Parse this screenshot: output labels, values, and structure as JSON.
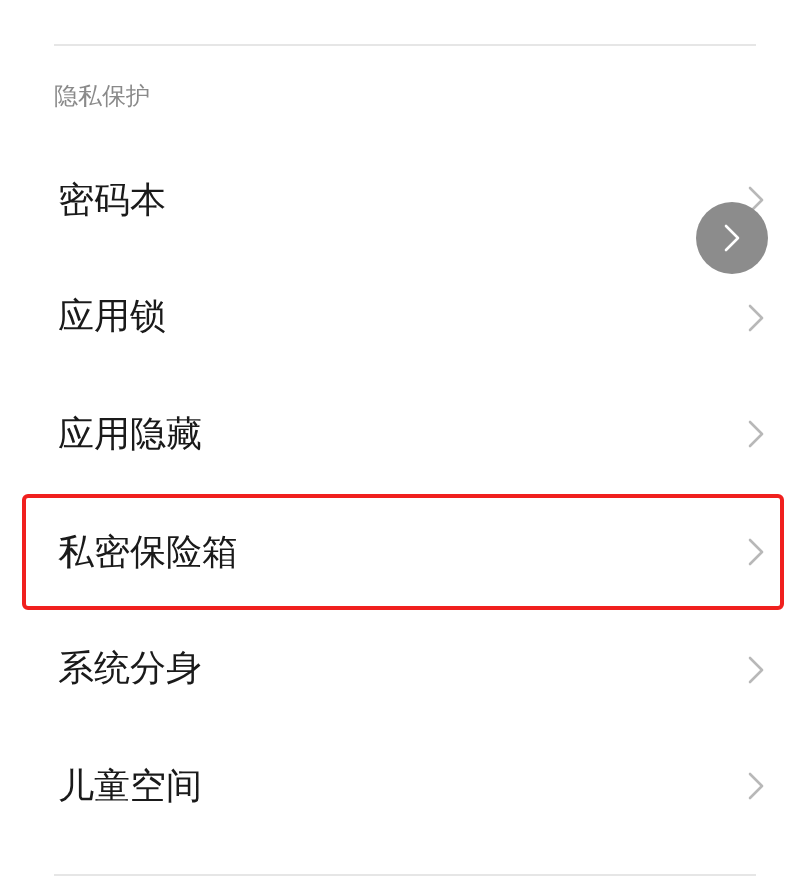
{
  "section": {
    "title": "隐私保护"
  },
  "items": [
    {
      "label": "密码本",
      "highlighted": false
    },
    {
      "label": "应用锁",
      "highlighted": false
    },
    {
      "label": "应用隐藏",
      "highlighted": false
    },
    {
      "label": "私密保险箱",
      "highlighted": true
    },
    {
      "label": "系统分身",
      "highlighted": false
    },
    {
      "label": "儿童空间",
      "highlighted": false
    }
  ]
}
